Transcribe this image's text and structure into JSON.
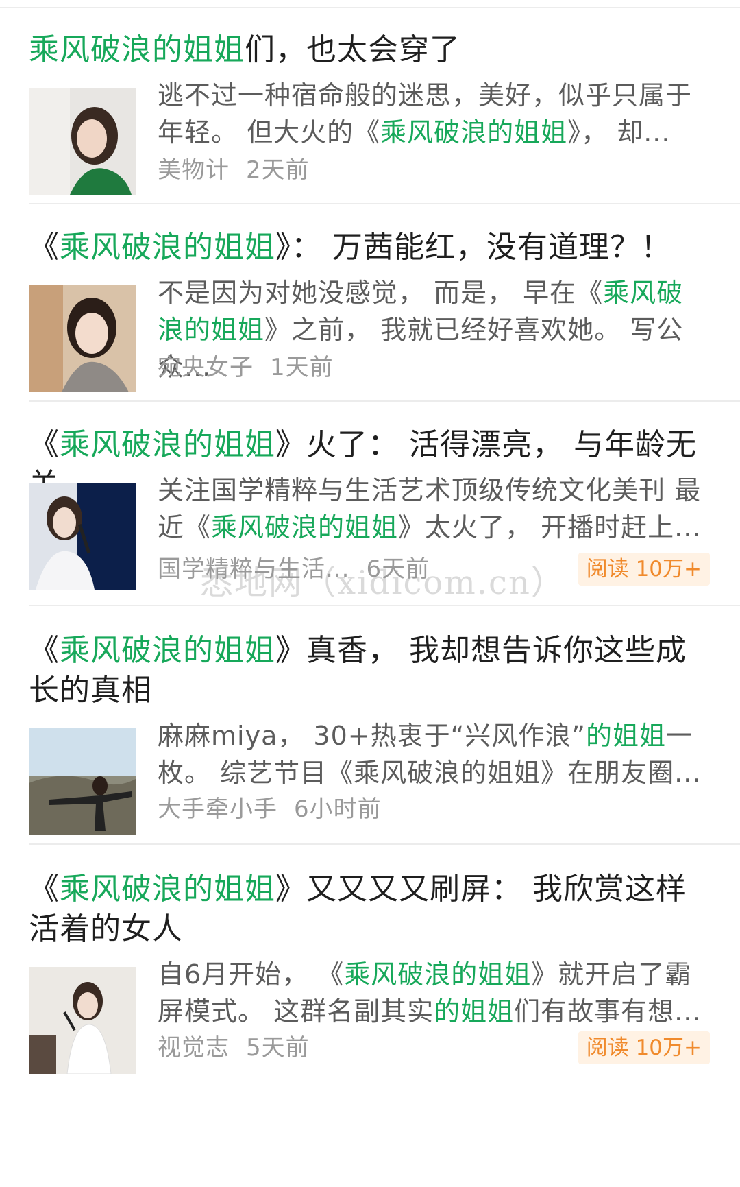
{
  "articles": [
    {
      "title_hl": "乘风破浪的姐姐",
      "title_rest": "们，也太会穿了",
      "snippet_pre": "逃不过一种宿命般的迷思，美好，似乎只属于年轻。 但大火的《",
      "snippet_hl": "乘风破浪的姐姐",
      "snippet_post": "》， 却...",
      "source": "美物计",
      "time": "2天前"
    },
    {
      "title_open": "《",
      "title_hl": "乘风破浪的姐姐",
      "title_rest": "》： 万茜能红，没有道理？！",
      "snippet_pre": "不是因为对她没感觉， 而是， 早在《",
      "snippet_hl": "乘风破浪的姐姐",
      "snippet_post": "》之前， 我就已经好喜欢她。 写公众...",
      "source": "宛央女子",
      "time": "1天前"
    },
    {
      "title_open": "《",
      "title_hl": "乘风破浪的姐姐",
      "title_rest": "》火了： 活得漂亮， 与年龄无关",
      "snippet_pre": "关注国学精粹与生活艺术顶级传统文化美刊 最近《",
      "snippet_hl": "乘风破浪的姐姐",
      "snippet_post": "》太火了， 开播时赶上...",
      "source": "国学精粹与生活...",
      "time": "6天前",
      "badge": "阅读 10万+"
    },
    {
      "title_open": "《",
      "title_hl": "乘风破浪的姐姐",
      "title_rest": "》真香， 我却想告诉你这些成长的真相",
      "snippet_pre": "麻麻miya， 30+热衷于“兴风作浪”",
      "snippet_hl": "的姐姐",
      "snippet_post": "一枚。 综艺节目《乘风破浪的姐姐》在朋友圈...",
      "snippet_hl2": "乘风破浪的姐姐",
      "source": "大手牵小手",
      "time": "6小时前"
    },
    {
      "title_open": "《",
      "title_hl": "乘风破浪的姐姐",
      "title_rest": "》又又又又刷屏： 我欣赏这样活着的女人",
      "snippet_pre": "自6月开始， 《",
      "snippet_hl": "乘风破浪的姐姐",
      "snippet_post": "》就开启了霸屏模式。 这群名副其实",
      "snippet_hl2": "的姐姐",
      "snippet_post2": "们有故事有想...",
      "source": "视觉志",
      "time": "5天前",
      "badge": "阅读 10万+"
    }
  ],
  "watermark": "悉地网（xidicom.cn）",
  "colors": {
    "highlight": "#17a85a",
    "badge_bg": "#fff2e4",
    "badge_text": "#f08a2c"
  }
}
